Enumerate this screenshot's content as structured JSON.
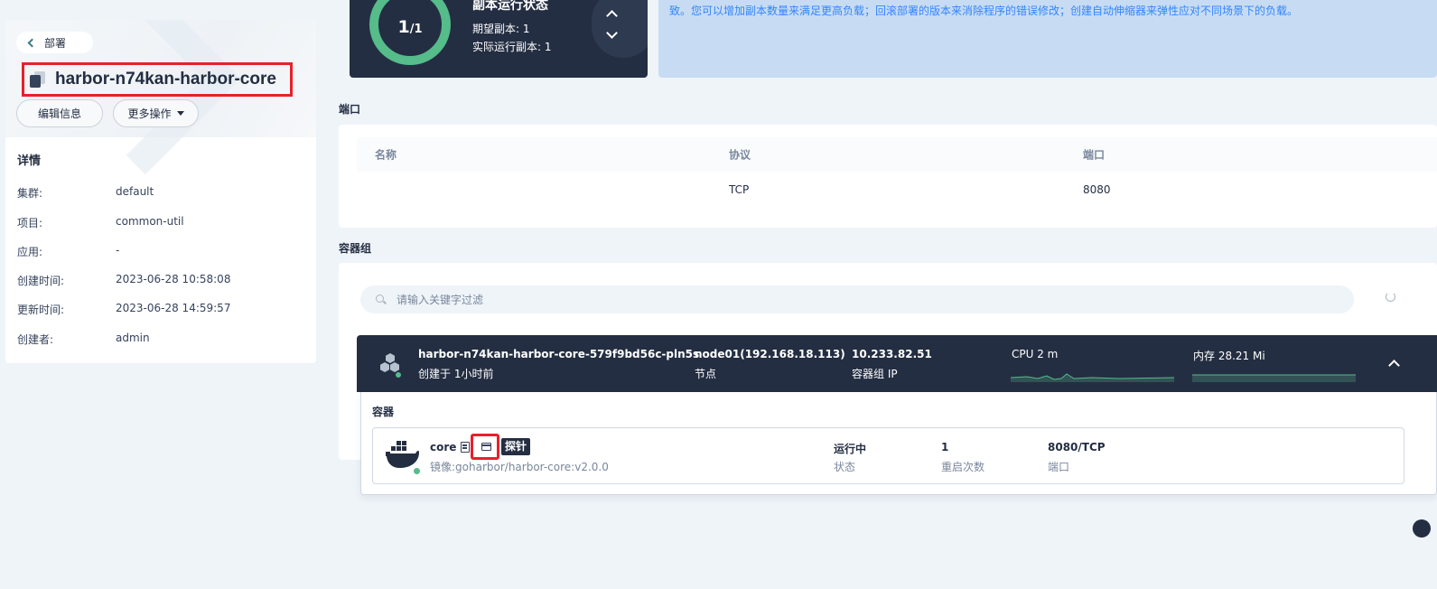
{
  "header": {
    "back_label": "部署",
    "title": "harbor-n74kan-harbor-core",
    "edit_button": "编辑信息",
    "more_button": "更多操作"
  },
  "details": {
    "title": "详情",
    "rows": [
      {
        "key": "集群:",
        "value": "default"
      },
      {
        "key": "项目:",
        "value": "common-util"
      },
      {
        "key": "应用:",
        "value": "-"
      },
      {
        "key": "创建时间:",
        "value": "2023-06-28 10:58:08"
      },
      {
        "key": "更新时间:",
        "value": "2023-06-28 14:59:57"
      },
      {
        "key": "创建者:",
        "value": "admin"
      }
    ]
  },
  "replica": {
    "current": "1",
    "total": "/1",
    "title": "副本运行状态",
    "desired": "期望副本: 1",
    "actual": "实际运行副本: 1"
  },
  "info_banner": {
    "text": "致。您可以增加副本数量来满足更高负载；回滚部署的版本来消除程序的错误修改；创建自动伸缩器来弹性应对不同场景下的负载。"
  },
  "ports": {
    "section_label": "端口",
    "headers": [
      "名称",
      "协议",
      "端口"
    ],
    "rows": [
      {
        "name": "",
        "protocol": "TCP",
        "port": "8080"
      }
    ]
  },
  "pods": {
    "section_label": "容器组",
    "search_placeholder": "请输入关键字过滤",
    "pod": {
      "name": "harbor-n74kan-harbor-core-579f9bd56c-pln5s",
      "created": "创建于 1小时前",
      "node": "node01(192.168.18.113)",
      "node_label": "节点",
      "ip": "10.233.82.51",
      "ip_label": "容器组 IP",
      "cpu": "CPU 2 m",
      "memory": "内存 28.21 Mi"
    },
    "containers_title": "容器",
    "container": {
      "name": "core",
      "probe": "探针",
      "image": "镜像:goharbor/harbor-core:v2.0.0",
      "status": "运行中",
      "status_label": "状态",
      "restarts": "1",
      "restarts_label": "重启次数",
      "ports": "8080/TCP",
      "ports_label": "端口"
    }
  },
  "colors": {
    "dark": "#242e42",
    "green": "#55bc8a",
    "highlight": "#e8202a",
    "info_bg": "#c7dcf2",
    "info_text": "#3385ff"
  }
}
